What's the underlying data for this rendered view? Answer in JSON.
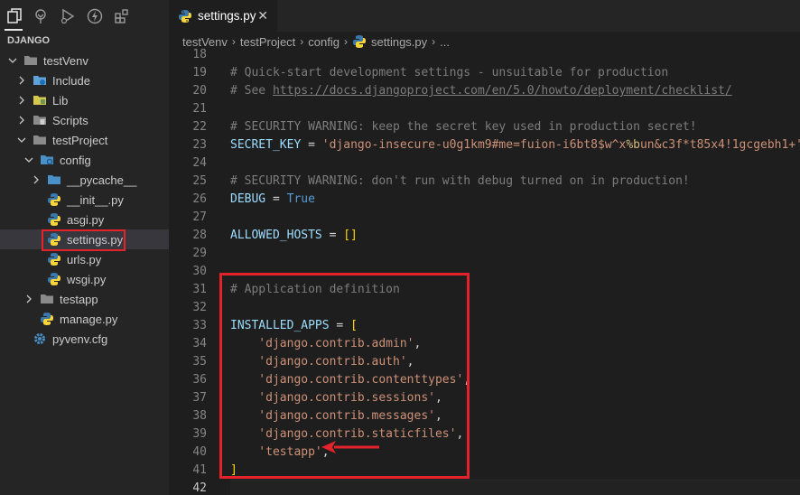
{
  "activity_bar": {
    "icons": [
      "files-icon",
      "source-control-icon",
      "run-debug-icon",
      "lightning-icon",
      "extensions-icon"
    ]
  },
  "explorer": {
    "title": "DJANGO",
    "items": [
      {
        "label": "testVenv",
        "kind": "folder",
        "open": true,
        "depth": 0
      },
      {
        "label": "Include",
        "kind": "folder-special",
        "open": false,
        "depth": 1
      },
      {
        "label": "Lib",
        "kind": "folder-lib",
        "open": false,
        "depth": 1
      },
      {
        "label": "Scripts",
        "kind": "folder-scripts",
        "open": false,
        "depth": 1
      },
      {
        "label": "testProject",
        "kind": "folder",
        "open": true,
        "depth": 1
      },
      {
        "label": "config",
        "kind": "folder-config",
        "open": true,
        "depth": 2
      },
      {
        "label": "__pycache__",
        "kind": "folder-blue",
        "open": false,
        "depth": 3
      },
      {
        "label": "__init__.py",
        "kind": "python",
        "depth": 3
      },
      {
        "label": "asgi.py",
        "kind": "python",
        "depth": 3
      },
      {
        "label": "settings.py",
        "kind": "python",
        "depth": 3,
        "selected": true
      },
      {
        "label": "urls.py",
        "kind": "python",
        "depth": 3
      },
      {
        "label": "wsgi.py",
        "kind": "python",
        "depth": 3
      },
      {
        "label": "testapp",
        "kind": "folder",
        "open": false,
        "depth": 2
      },
      {
        "label": "manage.py",
        "kind": "python",
        "depth": 2
      },
      {
        "label": "pyvenv.cfg",
        "kind": "gear",
        "depth": 1
      }
    ]
  },
  "tab": {
    "label": "settings.py",
    "close": "✕"
  },
  "breadcrumb": [
    "testVenv",
    "testProject",
    "config",
    "settings.py",
    "..."
  ],
  "code": {
    "current_line": "42",
    "lines": [
      {
        "n": "18",
        "tokens": []
      },
      {
        "n": "19",
        "tokens": [
          {
            "t": "# Quick-start development settings - unsuitable for production",
            "c": "cmt-plain"
          }
        ]
      },
      {
        "n": "20",
        "tokens": [
          {
            "t": "# See ",
            "c": "cmt-plain"
          },
          {
            "t": "https://docs.djangoproject.com/en/5.0/howto/deployment/checklist/",
            "c": "link"
          }
        ]
      },
      {
        "n": "21",
        "tokens": []
      },
      {
        "n": "22",
        "tokens": [
          {
            "t": "# SECURITY WARNING: keep the secret key used in production secret!",
            "c": "cmt-plain"
          }
        ]
      },
      {
        "n": "23",
        "tokens": [
          {
            "t": "SECRET_KEY",
            "c": "var"
          },
          {
            "t": " = ",
            "c": "op"
          },
          {
            "t": "'django-insecure-u0g1km9#me=fuion-i6bt8$w^x",
            "c": "str"
          },
          {
            "t": "%b",
            "c": "esc"
          },
          {
            "t": "un&c3f*t85x4!1gcgebh1+'",
            "c": "str"
          }
        ]
      },
      {
        "n": "24",
        "tokens": []
      },
      {
        "n": "25",
        "tokens": [
          {
            "t": "# SECURITY WARNING: don't run with debug turned on in production!",
            "c": "cmt-plain"
          }
        ]
      },
      {
        "n": "26",
        "tokens": [
          {
            "t": "DEBUG",
            "c": "var"
          },
          {
            "t": " = ",
            "c": "op"
          },
          {
            "t": "True",
            "c": "kw"
          }
        ]
      },
      {
        "n": "27",
        "tokens": []
      },
      {
        "n": "28",
        "tokens": [
          {
            "t": "ALLOWED_HOSTS",
            "c": "var"
          },
          {
            "t": " = ",
            "c": "op"
          },
          {
            "t": "[]",
            "c": "br"
          }
        ]
      },
      {
        "n": "29",
        "tokens": []
      },
      {
        "n": "30",
        "tokens": []
      },
      {
        "n": "31",
        "tokens": [
          {
            "t": "# Application definition",
            "c": "cmt-plain"
          }
        ]
      },
      {
        "n": "32",
        "tokens": []
      },
      {
        "n": "33",
        "tokens": [
          {
            "t": "INSTALLED_APPS",
            "c": "var"
          },
          {
            "t": " = ",
            "c": "op"
          },
          {
            "t": "[",
            "c": "br"
          }
        ]
      },
      {
        "n": "34",
        "tokens": [
          {
            "t": "    'django.contrib.admin'",
            "c": "str"
          },
          {
            "t": ",",
            "c": "op"
          }
        ]
      },
      {
        "n": "35",
        "tokens": [
          {
            "t": "    'django.contrib.auth'",
            "c": "str"
          },
          {
            "t": ",",
            "c": "op"
          }
        ]
      },
      {
        "n": "36",
        "tokens": [
          {
            "t": "    'django.contrib.contenttypes'",
            "c": "str"
          },
          {
            "t": ",",
            "c": "op"
          }
        ]
      },
      {
        "n": "37",
        "tokens": [
          {
            "t": "    'django.contrib.sessions'",
            "c": "str"
          },
          {
            "t": ",",
            "c": "op"
          }
        ]
      },
      {
        "n": "38",
        "tokens": [
          {
            "t": "    'django.contrib.messages'",
            "c": "str"
          },
          {
            "t": ",",
            "c": "op"
          }
        ]
      },
      {
        "n": "39",
        "tokens": [
          {
            "t": "    'django.contrib.staticfiles'",
            "c": "str"
          },
          {
            "t": ",",
            "c": "op"
          }
        ]
      },
      {
        "n": "40",
        "tokens": [
          {
            "t": "    'testapp'",
            "c": "str"
          },
          {
            "t": ",",
            "c": "op"
          }
        ]
      },
      {
        "n": "41",
        "tokens": [
          {
            "t": "]",
            "c": "br"
          }
        ]
      },
      {
        "n": "42",
        "tokens": []
      }
    ]
  },
  "colors": {
    "highlight": "#e3222a",
    "python_blue": "#3b77a8",
    "python_yellow": "#f7d43a"
  }
}
